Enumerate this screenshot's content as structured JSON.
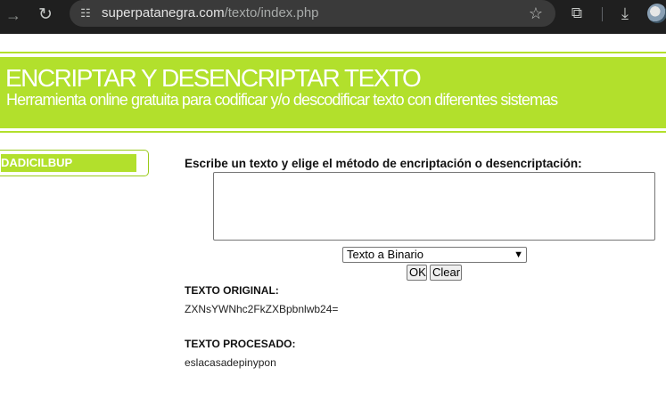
{
  "browser": {
    "url_host": "superpatanegra.com",
    "url_path": "/texto/index.php",
    "icons": {
      "forward": "arrow-right-icon",
      "reload": "reload-icon",
      "site_info": "site-info-icon",
      "bookmark": "star-icon",
      "extensions": "puzzle-icon",
      "downloads": "download-icon",
      "profile": "avatar"
    }
  },
  "header": {
    "title": "ENCRIPTAR Y DESENCRIPTAR TEXTO",
    "subtitle": "Herramienta online gratuita para codificar y/o descodificar texto con diferentes sistemas",
    "accent_color": "#b2e02c"
  },
  "sidebar": {
    "link_label": "DADICILBUP"
  },
  "form": {
    "prompt": "Escribe un texto y elige el método de encriptación o desencriptación:",
    "textarea_value": "",
    "method_selected": "Texto a Binario",
    "ok_label": "OK",
    "clear_label": "Clear"
  },
  "results": {
    "original_label": "TEXTO ORIGINAL:",
    "original_value": "ZXNsYWNhc2FkZXBpbnlwb24=",
    "processed_label": "TEXTO PROCESADO:",
    "processed_value": "eslacasadepinypon"
  }
}
